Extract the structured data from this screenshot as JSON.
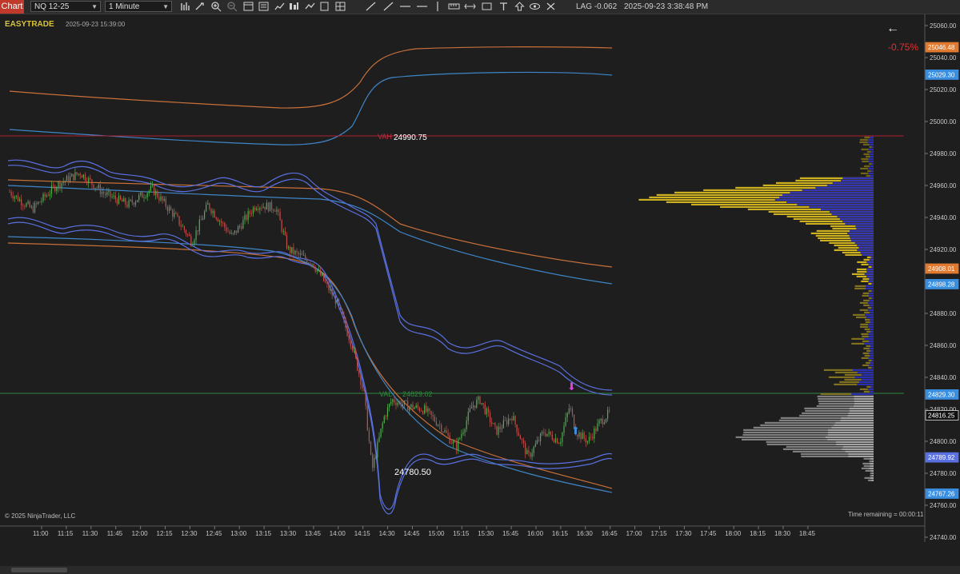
{
  "toolbar": {
    "chart_label": "Chart",
    "instrument": "NQ 12-25",
    "interval": "1 Minute",
    "lag": "LAG -0.062",
    "datetime": "2025-09-23 3:38:48 PM"
  },
  "chart": {
    "indicator_label": "EASYTRADE",
    "session_text": "2025-09-23 15:39:00",
    "copyright": "© 2025 NinjaTrader, LLC",
    "time_remaining": "Time remaining = 00:00:11",
    "percent_change": "-0.75%",
    "vah_label": "VAH",
    "vah_value": "24990.75",
    "low_label": "24780.50",
    "val_label": "VAL",
    "val_value": "24829.02",
    "back_icon": "arrow-left-icon",
    "colors": {
      "background": "#1e1e1e",
      "bull": "#4fb04f",
      "bear": "#c0504d",
      "band_blue": "#4a64c8",
      "band_orange": "#c8703a",
      "band_lightblue": "#3f86c8",
      "vah_line": "#b02030",
      "val_line": "#2e8b3e",
      "profile_yellow": "#e0c020",
      "profile_blue": "#1a22cc",
      "profile_gray": "#c8c8c8",
      "percent": "#e03030"
    }
  },
  "price_axis": {
    "ticks": [
      "25060.00",
      "25040.00",
      "25020.00",
      "25000.00",
      "24980.00",
      "24960.00",
      "24940.00",
      "24920.00",
      "24900.00",
      "24880.00",
      "24860.00",
      "24840.00",
      "24820.00",
      "24800.00",
      "24780.00",
      "24760.00",
      "24740.00"
    ],
    "markers": [
      {
        "label": "25046.48",
        "color": "#e07a30"
      },
      {
        "label": "25029.30",
        "color": "#3a8ee0"
      },
      {
        "label": "24908.01",
        "color": "#e07a30"
      },
      {
        "label": "24898.28",
        "color": "#3a8ee0"
      },
      {
        "label": "24829.30",
        "color": "#3a8ee0"
      },
      {
        "label": "24816.25",
        "color": "#111111"
      },
      {
        "label": "24789.92",
        "color": "#5a70e0"
      },
      {
        "label": "24767.26",
        "color": "#3a8ee0"
      }
    ]
  },
  "time_axis": {
    "ticks": [
      "11:00",
      "11:15",
      "11:30",
      "11:45",
      "12:00",
      "12:15",
      "12:30",
      "12:45",
      "13:00",
      "13:15",
      "13:30",
      "13:45",
      "14:00",
      "14:15",
      "14:30",
      "14:45",
      "15:00",
      "15:15",
      "15:30",
      "15:45",
      "16:00",
      "16:15",
      "16:30",
      "16:45",
      "17:00",
      "17:15",
      "17:30",
      "17:45",
      "18:00",
      "18:15",
      "18:30",
      "18:45"
    ]
  }
}
